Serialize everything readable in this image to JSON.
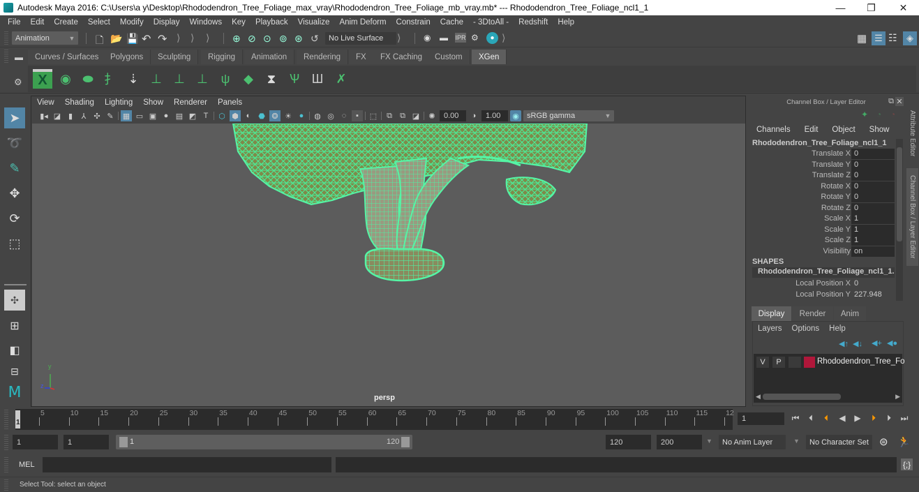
{
  "window": {
    "title": "Autodesk Maya 2016: C:\\Users\\a y\\Desktop\\Rhododendron_Tree_Foliage_max_vray\\Rhododendron_Tree_Foliage_mb_vray.mb*  ---  Rhododendron_Tree_Foliage_ncl1_1",
    "minimize": "—",
    "restore": "❐",
    "close": "✕"
  },
  "menubar": [
    "File",
    "Edit",
    "Create",
    "Select",
    "Modify",
    "Display",
    "Windows",
    "Key",
    "Playback",
    "Visualize",
    "Anim Deform",
    "Constrain",
    "Cache",
    "- 3DtoAll -",
    "Redshift",
    "Help"
  ],
  "statusline": {
    "menuset": "Animation",
    "live_surface": "No Live Surface"
  },
  "shelf": {
    "tabs": [
      "Curves / Surfaces",
      "Polygons",
      "Sculpting",
      "Rigging",
      "Animation",
      "Rendering",
      "FX",
      "FX Caching",
      "Custom",
      "XGen"
    ],
    "active_tab": "XGen",
    "icons": [
      "xgen-window-icon",
      "xgen-preview-icon",
      "xgen-clear-preview-icon",
      "add-guides-icon",
      "place-guides-icon",
      "add-guide-icon",
      "select-guide-icon",
      "lock-guide-icon",
      "guides-icon",
      "xgen-grid-icon",
      "guide-to-curves-icon",
      "sculpt-guides-icon",
      "bind-guides-icon",
      "delete-guides-icon"
    ]
  },
  "viewport": {
    "menu": [
      "View",
      "Shading",
      "Lighting",
      "Show",
      "Renderer",
      "Panels"
    ],
    "exposure": "0.00",
    "gamma": "1.00",
    "color_space": "sRGB gamma",
    "camera": "persp",
    "axis": {
      "x": "x",
      "y": "y",
      "z": "z"
    }
  },
  "channelbox": {
    "header": "Channel Box / Layer Editor",
    "menu": [
      "Channels",
      "Edit",
      "Object",
      "Show"
    ],
    "object_name": "Rhododendron_Tree_Foliage_ncl1_1",
    "channels": [
      {
        "label": "Translate X",
        "value": "0"
      },
      {
        "label": "Translate Y",
        "value": "0"
      },
      {
        "label": "Translate Z",
        "value": "0"
      },
      {
        "label": "Rotate X",
        "value": "0"
      },
      {
        "label": "Rotate Y",
        "value": "0"
      },
      {
        "label": "Rotate Z",
        "value": "0"
      },
      {
        "label": "Scale X",
        "value": "1"
      },
      {
        "label": "Scale Y",
        "value": "1"
      },
      {
        "label": "Scale Z",
        "value": "1"
      },
      {
        "label": "Visibility",
        "value": "on"
      }
    ],
    "shapes_header": "SHAPES",
    "shape_name": "Rhododendron_Tree_Foliage_ncl1_1...",
    "shape_channels": [
      {
        "label": "Local Position X",
        "value": "0"
      },
      {
        "label": "Local Position Y",
        "value": "227.948"
      }
    ]
  },
  "layer_editor": {
    "tabs": [
      "Display",
      "Render",
      "Anim"
    ],
    "active_tab": "Display",
    "menu": [
      "Layers",
      "Options",
      "Help"
    ],
    "layers": [
      {
        "v": "V",
        "p": "P",
        "color": "#b0173a",
        "name": "Rhododendron_Tree_Fo"
      }
    ]
  },
  "side_tabs": [
    "Attribute Editor",
    "Channel Box / Layer Editor"
  ],
  "timeslider": {
    "ticks": [
      5,
      10,
      15,
      20,
      25,
      30,
      35,
      40,
      45,
      50,
      55,
      60,
      65,
      70,
      75,
      80,
      85,
      90,
      95,
      100,
      105,
      110,
      115,
      12
    ],
    "current_frame_marker": "1",
    "current_frame": "1"
  },
  "rangeslider": {
    "start": "1",
    "playback_start": "1",
    "range_min_label": "1",
    "range_max_label": "120",
    "playback_end": "120",
    "end": "200",
    "anim_layer": "No Anim Layer",
    "character_set": "No Character Set"
  },
  "cmdline": {
    "label": "MEL"
  },
  "helpline": {
    "text": "Select Tool: select an object"
  },
  "colors": {
    "accent": "#5285a6",
    "wireframe": "#4cf0a0",
    "layer_color": "#b0173a"
  }
}
